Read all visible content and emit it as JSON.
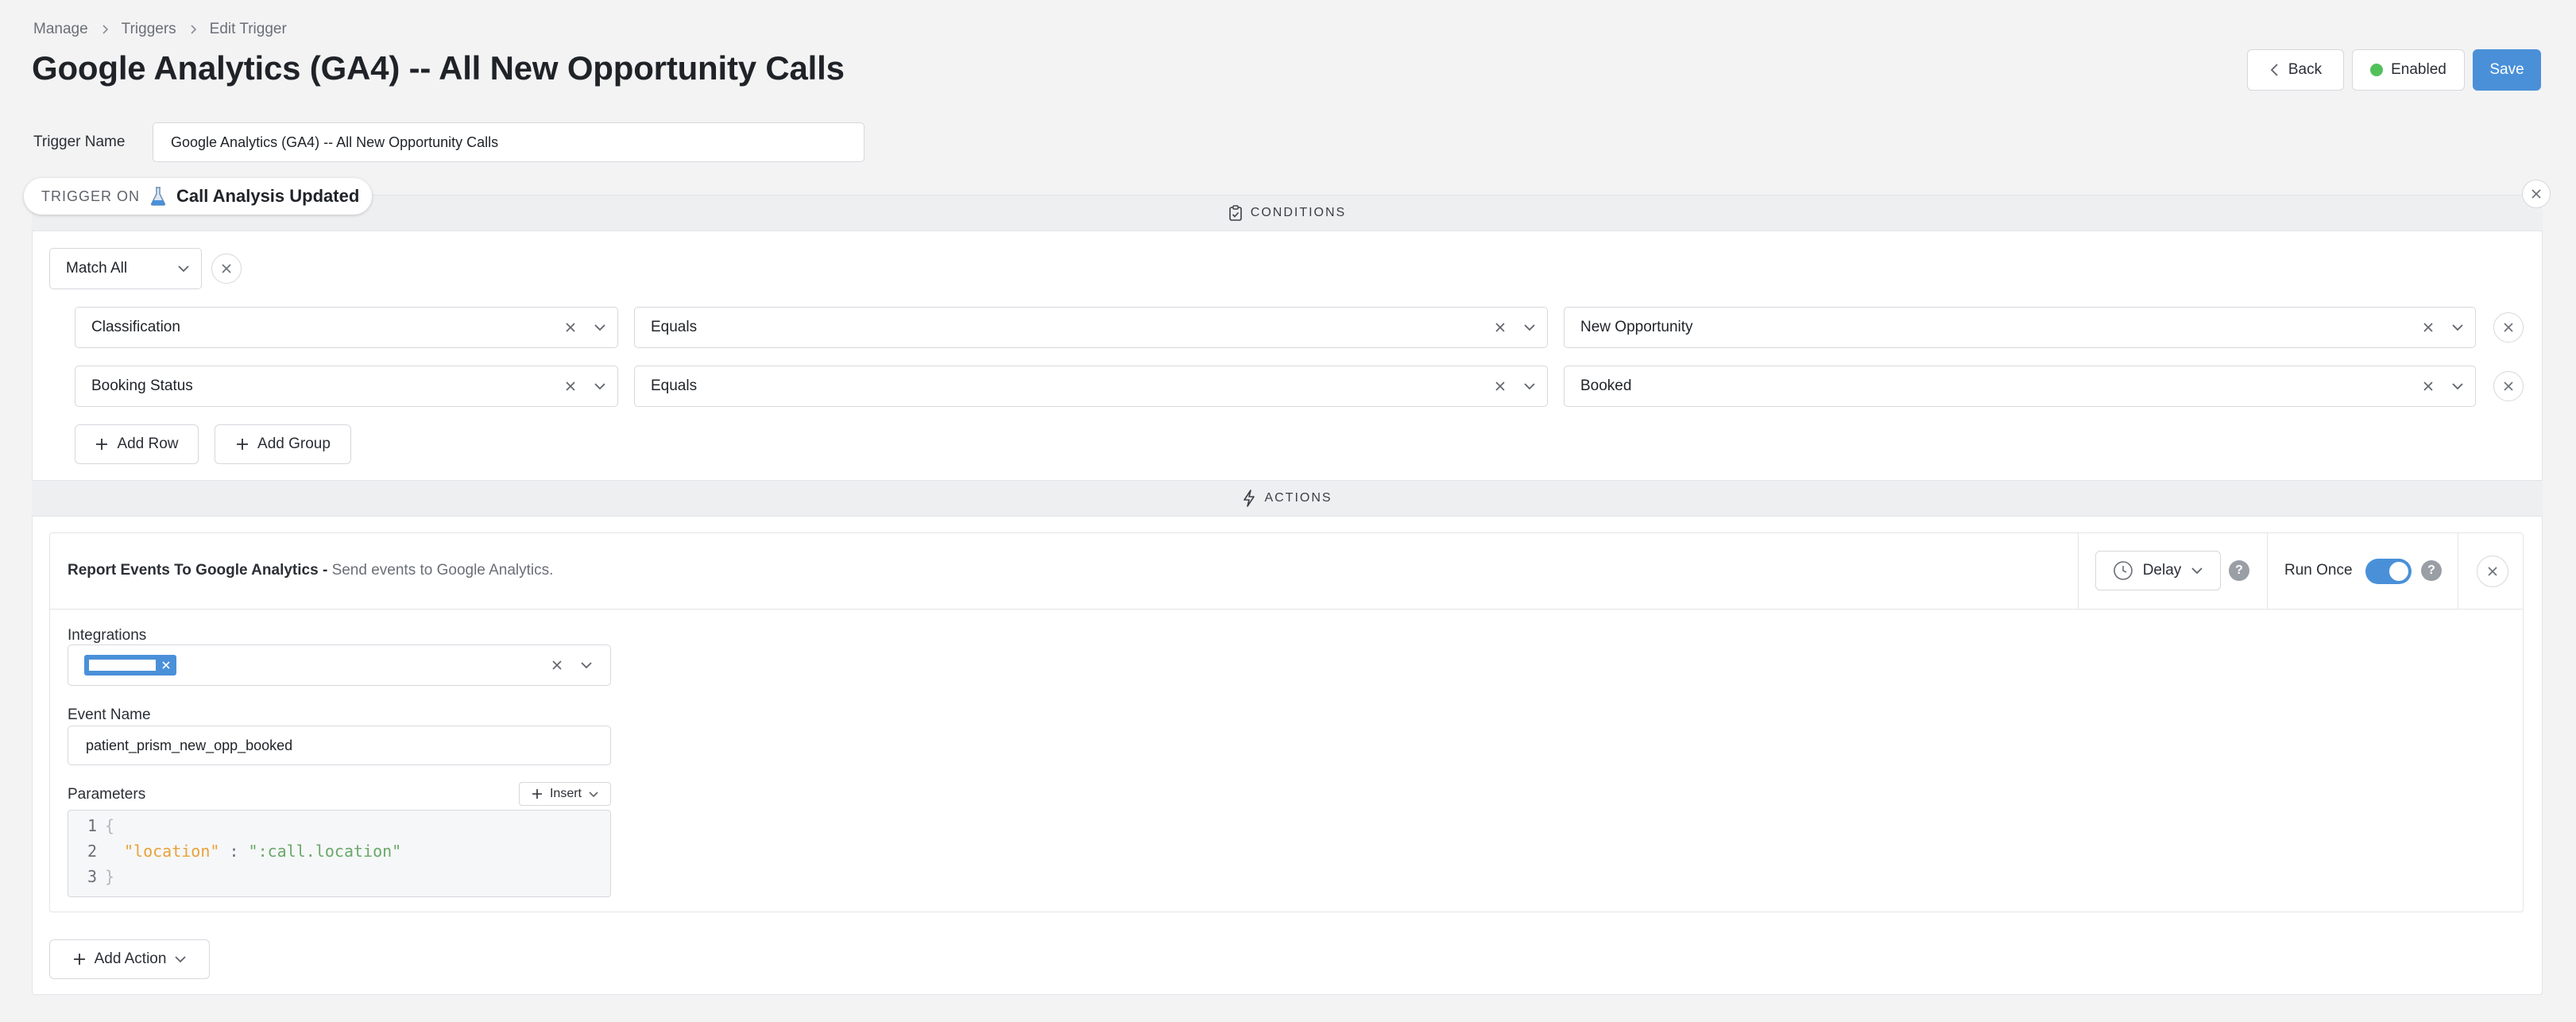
{
  "breadcrumb": [
    "Manage",
    "Triggers",
    "Edit Trigger"
  ],
  "page_title": "Google Analytics (GA4) -- All New Opportunity Calls",
  "header_buttons": {
    "back": "Back",
    "enabled": "Enabled",
    "save": "Save"
  },
  "colors": {
    "accent": "#4a90d9",
    "enabled_dot": "#52c15a"
  },
  "trigger_name": {
    "label": "Trigger Name",
    "value": "Google Analytics (GA4) -- All New Opportunity Calls"
  },
  "trigger_on": {
    "label": "TRIGGER ON",
    "event": "Call Analysis Updated",
    "icon": "flask-icon"
  },
  "conditions": {
    "header": "CONDITIONS",
    "match": "Match All",
    "rows": [
      {
        "field": "Classification",
        "operator": "Equals",
        "value": "New Opportunity"
      },
      {
        "field": "Booking Status",
        "operator": "Equals",
        "value": "Booked"
      }
    ],
    "add_row": "Add Row",
    "add_group": "Add Group"
  },
  "actions": {
    "header": "ACTIONS",
    "card": {
      "title": "Report Events To Google Analytics -",
      "description": "Send events to Google Analytics.",
      "delay": "Delay",
      "run_once": "Run Once",
      "run_once_enabled": true,
      "integrations_label": "Integrations",
      "event_name_label": "Event Name",
      "event_name_value": "patient_prism_new_opp_booked",
      "parameters_label": "Parameters",
      "insert": "Insert",
      "code_lines": [
        {
          "n": "1",
          "text": "{"
        },
        {
          "n": "2",
          "key": "\"location\"",
          "sep": " : ",
          "val": "\":call.location\""
        },
        {
          "n": "3",
          "text": "}"
        }
      ]
    },
    "add_action": "Add Action"
  }
}
